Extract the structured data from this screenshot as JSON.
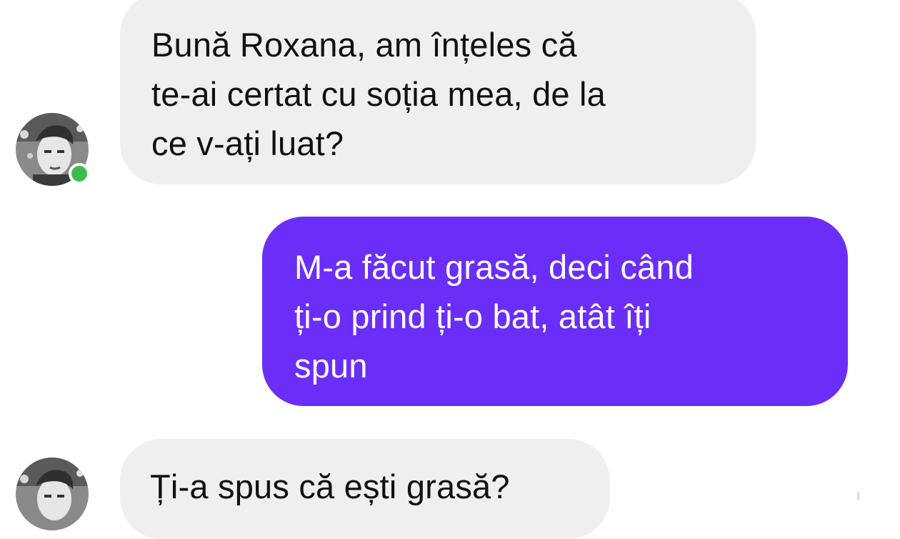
{
  "conversation": {
    "messages": [
      {
        "direction": "incoming",
        "lines": [
          "Bună Roxana, am înțeles că",
          "te-ai certat cu soția mea, de la",
          "ce v-ați luat?"
        ]
      },
      {
        "direction": "outgoing",
        "lines": [
          "M-a făcut grasă, deci când",
          "ți-o prind ți-o bat, atât îți",
          "spun"
        ]
      },
      {
        "direction": "incoming",
        "lines": [
          "Ți-a spus că ești grasă?"
        ]
      }
    ],
    "contact_status": "online"
  },
  "colors": {
    "accent": "#6a2ef8",
    "incoming_bubble": "#efefef",
    "online_dot": "#3cbc4d"
  },
  "icons": {
    "avatar": "profile-photo",
    "status": "online-dot"
  }
}
